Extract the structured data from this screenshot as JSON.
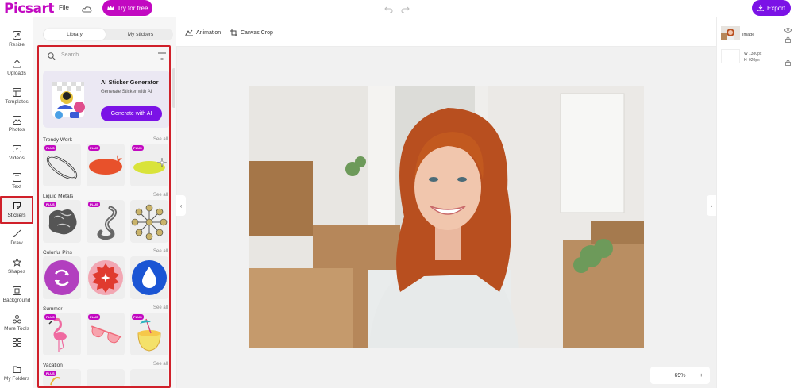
{
  "header": {
    "logo": "Picsart",
    "file_menu": "File",
    "try_label": "Try for free",
    "export_label": "Export"
  },
  "nav": [
    {
      "label": "Resize",
      "icon": "resize-icon"
    },
    {
      "label": "Uploads",
      "icon": "upload-icon"
    },
    {
      "label": "Templates",
      "icon": "templates-icon"
    },
    {
      "label": "Photos",
      "icon": "photos-icon"
    },
    {
      "label": "Videos",
      "icon": "videos-icon"
    },
    {
      "label": "Text",
      "icon": "text-icon"
    },
    {
      "label": "Stickers",
      "icon": "sticker-icon",
      "active": true
    },
    {
      "label": "Draw",
      "icon": "brush-icon"
    },
    {
      "label": "Shapes",
      "icon": "star-icon"
    },
    {
      "label": "Background",
      "icon": "background-icon"
    },
    {
      "label": "More Tools",
      "icon": "more-tools-icon"
    },
    {
      "label": "My Folders",
      "icon": "folder-icon"
    }
  ],
  "panel": {
    "tabs": [
      "Library",
      "My stickers"
    ],
    "active_tab": "Library",
    "search_placeholder": "Search",
    "ai_card": {
      "title": "AI Sticker Generator",
      "subtitle": "Generate Sticker with AI",
      "button": "Generate with AI"
    },
    "see_all": "See all",
    "plus_badge": "PLUS",
    "categories": [
      {
        "title": "Trendy Work"
      },
      {
        "title": "Liquid Metals"
      },
      {
        "title": "Colorful Pins"
      },
      {
        "title": "Summer"
      },
      {
        "title": "Vacation"
      }
    ]
  },
  "toolbar": {
    "animation": "Animation",
    "canvas_crop": "Canvas Crop"
  },
  "zoom": {
    "minus": "−",
    "value": "69%",
    "plus": "+"
  },
  "layers": {
    "image_label": "Image",
    "width_label": "W",
    "width_value": "1380px",
    "height_label": "H",
    "height_value": "920px"
  },
  "colors": {
    "brand": "#c209c1",
    "accent": "#7b12e6",
    "highlight": "#d0202a"
  }
}
